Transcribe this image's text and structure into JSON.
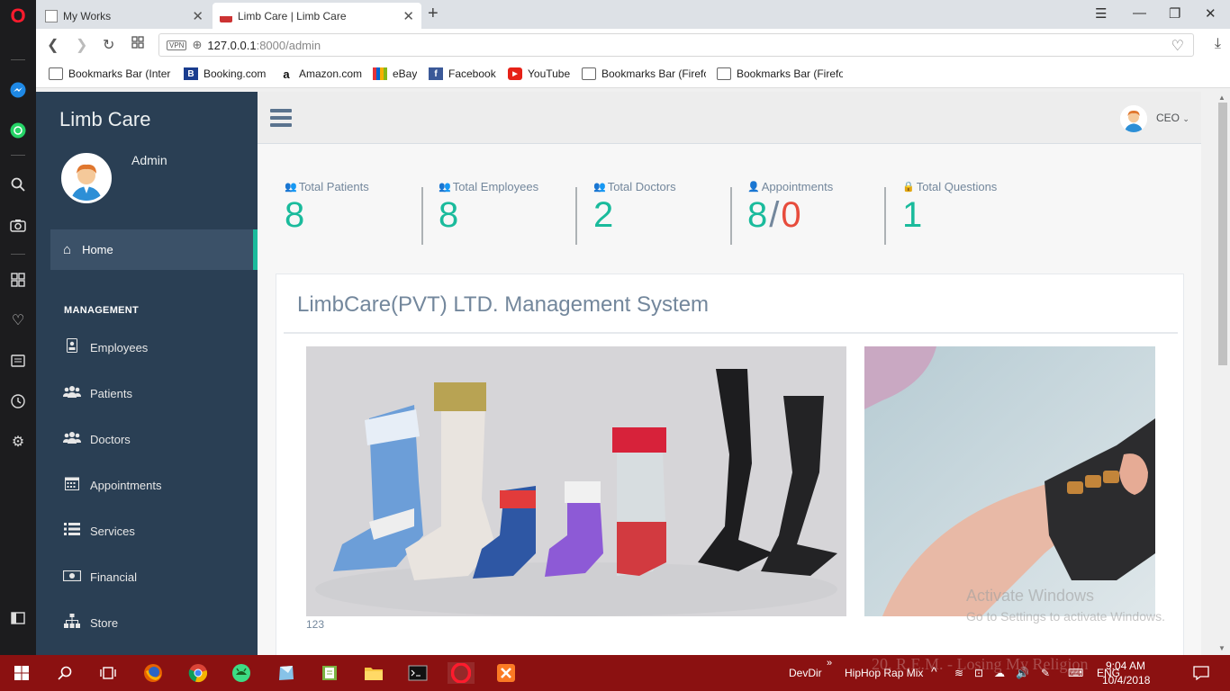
{
  "browser": {
    "tabs": [
      {
        "label": "My Works",
        "active": false
      },
      {
        "label": "Limb Care | Limb Care",
        "active": true
      }
    ],
    "url_host": "127.0.0.1",
    "url_path": ":8000/admin",
    "vpn_label": "VPN",
    "bookmarks": [
      {
        "label": "Bookmarks Bar (Inter",
        "icon": "folder-icon"
      },
      {
        "label": "Booking.com",
        "icon": "booking-icon"
      },
      {
        "label": "Amazon.com",
        "icon": "amazon-icon"
      },
      {
        "label": "eBay",
        "icon": "ebay-icon"
      },
      {
        "label": "Facebook",
        "icon": "facebook-icon"
      },
      {
        "label": "YouTube",
        "icon": "youtube-icon"
      },
      {
        "label": "Bookmarks Bar (Firefo",
        "icon": "folder-icon"
      },
      {
        "label": "Bookmarks Bar (Firefo",
        "icon": "folder-icon"
      }
    ]
  },
  "sidebar": {
    "brand": "Limb Care",
    "user_name": "Admin",
    "home_label": "Home",
    "section_label": "MANAGEMENT",
    "items": [
      {
        "label": "Employees",
        "icon": "id-card-icon"
      },
      {
        "label": "Patients",
        "icon": "users-icon"
      },
      {
        "label": "Doctors",
        "icon": "users-icon"
      },
      {
        "label": "Appointments",
        "icon": "calendar-icon"
      },
      {
        "label": "Services",
        "icon": "list-icon"
      },
      {
        "label": "Financial",
        "icon": "money-icon"
      },
      {
        "label": "Store",
        "icon": "sitemap-icon"
      }
    ]
  },
  "topnav": {
    "user_role": "CEO"
  },
  "stats": [
    {
      "label": "Total Patients",
      "value": "8"
    },
    {
      "label": "Total Employees",
      "value": "8"
    },
    {
      "label": "Total Doctors",
      "value": "2"
    },
    {
      "label": "Appointments",
      "value": "8",
      "value_secondary": "0"
    },
    {
      "label": "Total Questions",
      "value": "1"
    }
  ],
  "panel": {
    "title": "LimbCare(PVT) LTD. Management System",
    "caption": "123"
  },
  "watermark": {
    "line1": "Activate Windows",
    "line2": "Go to Settings to activate Windows."
  },
  "taskbar": {
    "devdir": "DevDir",
    "media": "HipHop Rap Mix",
    "song": "20. R.E.M. - Losing My Religion",
    "lang": "ENG",
    "time": "9:04 AM",
    "date": "10/4/2018"
  },
  "colors": {
    "sidebar_bg": "#2a3f54",
    "accent": "#1abb9c",
    "danger": "#e74c3c",
    "muted": "#73879c",
    "taskbar": "#8b1111"
  }
}
